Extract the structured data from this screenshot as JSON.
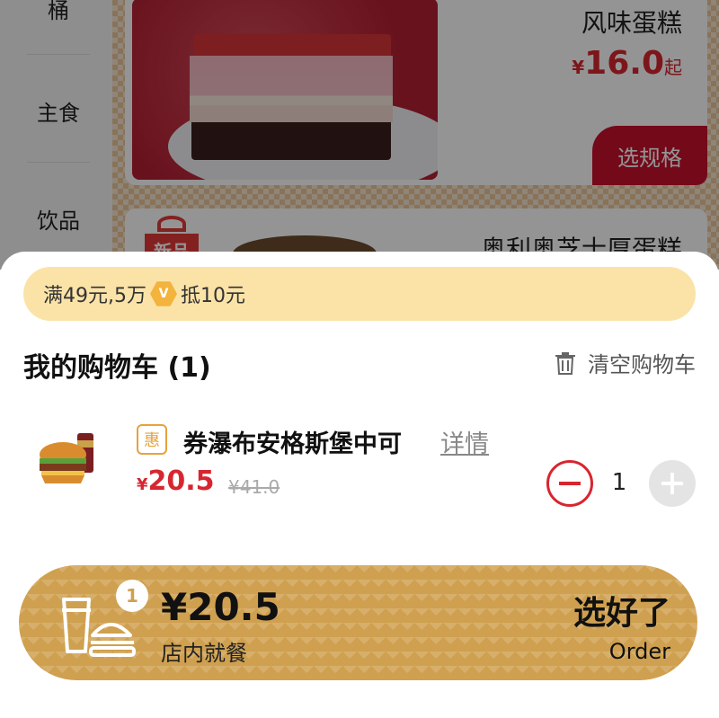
{
  "menu": {
    "categories": [
      "桶",
      "主食",
      "饮品"
    ],
    "products": [
      {
        "name": "风味蛋糕",
        "currency": "¥",
        "price": "16.0",
        "price_suffix": "起",
        "spec_label": "选规格"
      },
      {
        "name": "奥利奥芝士厚蛋糕",
        "badge": "新品"
      }
    ]
  },
  "promo": {
    "text_before": "满49元,5万",
    "text_after": "抵10元",
    "coin_icon": "coin-icon"
  },
  "cart": {
    "title": "我的购物车 (1)",
    "clear_label": "清空购物车",
    "items": [
      {
        "tag": "惠",
        "name": "券瀑布安格斯堡中可",
        "detail_label": "详情",
        "currency": "¥",
        "price": "20.5",
        "original_price": "¥41.0",
        "quantity": "1"
      }
    ]
  },
  "checkout": {
    "badge_count": "1",
    "total": "¥20.5",
    "dine_mode": "店内就餐",
    "order_label_cn": "选好了",
    "order_label_en": "Order",
    "accent_color": "#cfa04f"
  },
  "colors": {
    "primary_red": "#d7262f",
    "promo_bg": "#fbe3a8",
    "checkout_bg": "#cfa04f"
  }
}
